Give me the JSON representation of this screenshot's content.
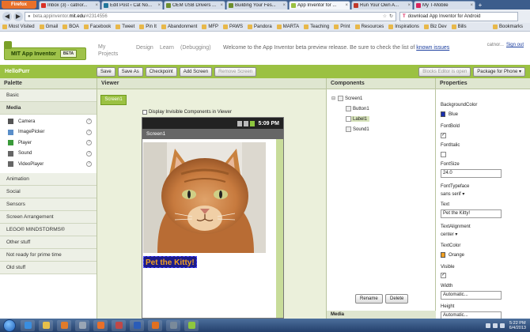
{
  "browser": {
    "firefox_button": "Firefox",
    "tabs": [
      {
        "label": "Inbox (3) - catnor...",
        "color": "#d93025",
        "active": false
      },
      {
        "label": "Edit Post ‹ Cat No...",
        "color": "#21759b",
        "active": false
      },
      {
        "label": "OEM USB Drivers ...",
        "color": "#6d8f2f",
        "active": false
      },
      {
        "label": "Building Your Fes...",
        "color": "#6d8f2f",
        "active": false
      },
      {
        "label": "App Inventor for ...",
        "color": "#9bc142",
        "active": true
      },
      {
        "label": "Run Your Own A...",
        "color": "#c0392b",
        "active": false
      },
      {
        "label": "My T-Mobile",
        "color": "#d8235c",
        "active": false
      }
    ],
    "new_tab": "+",
    "url_path_before": "beta.appinventor.",
    "url_domain": "mit.edu",
    "url_path_after": "/#2314556",
    "search_prefix": "T",
    "search_text": "download App Inventor for Android",
    "bookmarks": [
      "Most Visited",
      "Gmail",
      "BOA",
      "Facebook",
      "Tweet",
      "Pin It",
      "Abandonment",
      "MFP",
      "PAWS",
      "Pandora",
      "MARTA",
      "Teaching",
      "Print",
      "Resources",
      "Inspirations",
      "Biz Dev",
      "Bills"
    ],
    "bookmarks_menu": "Bookmarks"
  },
  "app": {
    "logo_text": "MIT App Inventor",
    "beta_badge": "BETA",
    "nav": {
      "my_projects": "My Projects",
      "design": "Design",
      "learn": "Learn",
      "debugging": "(Debugging)"
    },
    "welcome": "Welcome to the App Inventor beta preview release. Be sure to check the list of",
    "known_issues": "known issues",
    "user_email": "catnor...",
    "sign_out": "Sign out"
  },
  "project": {
    "name": "HelloPurr",
    "buttons": [
      "Save",
      "Save As",
      "Checkpoint",
      "Add Screen",
      "Remove Screen"
    ],
    "blocks_editor": "Blocks Editor is open",
    "package": "Package for Phone ▾"
  },
  "palette": {
    "header": "Palette",
    "categories_top": [
      "Basic",
      "Media"
    ],
    "media_items": [
      {
        "label": "Camera",
        "icon": "camera-icon",
        "color": "#555"
      },
      {
        "label": "ImagePicker",
        "icon": "image-icon",
        "color": "#5a8ec9"
      },
      {
        "label": "Player",
        "icon": "play-icon",
        "color": "#3a9a3a"
      },
      {
        "label": "Sound",
        "icon": "speaker-icon",
        "color": "#666"
      },
      {
        "label": "VideoPlayer",
        "icon": "film-icon",
        "color": "#666"
      }
    ],
    "categories_bottom": [
      "Animation",
      "Social",
      "Sensors",
      "Screen Arrangement",
      "LEGO® MINDSTORMS®",
      "Other stuff",
      "Not ready for prime time",
      "Old stuff"
    ]
  },
  "viewer": {
    "header": "Viewer",
    "screen_tab": "Screen1",
    "checkbox_label": "Display Invisible Components in Viewer",
    "clock": "5:09 PM",
    "screen_title": "Screen1",
    "label_text": "Pet the Kitty!",
    "label_bg": "#1b1b8c",
    "label_fg": "#f2a020"
  },
  "components": {
    "header": "Components",
    "root": "Screen1",
    "children": [
      "Button1",
      "Label1",
      "Sound1"
    ],
    "rename": "Rename",
    "delete": "Delete",
    "media_header": "Media"
  },
  "properties": {
    "header": "Properties",
    "bg_label": "BackgroundColor",
    "bg_value": "Blue",
    "bg_color": "#1a2fb0",
    "fontbold_label": "FontBold",
    "fontbold_mark": "✓",
    "fontitalic_label": "FontItalic",
    "fontsize_label": "FontSize",
    "fontsize_value": "24.0",
    "typeface_label": "FontTypeface",
    "typeface_value": "sans serif ▾",
    "text_label": "Text",
    "text_value": "Pet the Kitty!",
    "align_label": "TextAlignment",
    "align_value": "center ▾",
    "textcolor_label": "TextColor",
    "textcolor_value": "Orange",
    "textcolor_color": "#f2a020",
    "visible_label": "Visible",
    "visible_mark": "✓",
    "width_label": "Width",
    "width_value": "Automatic...",
    "height_label": "Height",
    "height_value": "Automatic..."
  },
  "taskbar": {
    "apps": [
      {
        "icon": "ie-icon",
        "color": "#3a8ee0"
      },
      {
        "icon": "folder-icon",
        "color": "#e8c04a"
      },
      {
        "icon": "media-player-icon",
        "color": "#e07b2a"
      },
      {
        "icon": "calculator-icon",
        "color": "#9aa6b5"
      },
      {
        "icon": "firefox-icon",
        "color": "#e8702a"
      },
      {
        "icon": "paint-icon",
        "color": "#c04848"
      },
      {
        "icon": "word-icon",
        "color": "#2a5cb8"
      },
      {
        "icon": "java-icon",
        "color": "#e07020"
      },
      {
        "icon": "zip-icon",
        "color": "#7a8a9a"
      },
      {
        "icon": "android-icon",
        "color": "#8ec63f"
      }
    ],
    "time": "5:22 PM",
    "date": "6/4/2013"
  }
}
